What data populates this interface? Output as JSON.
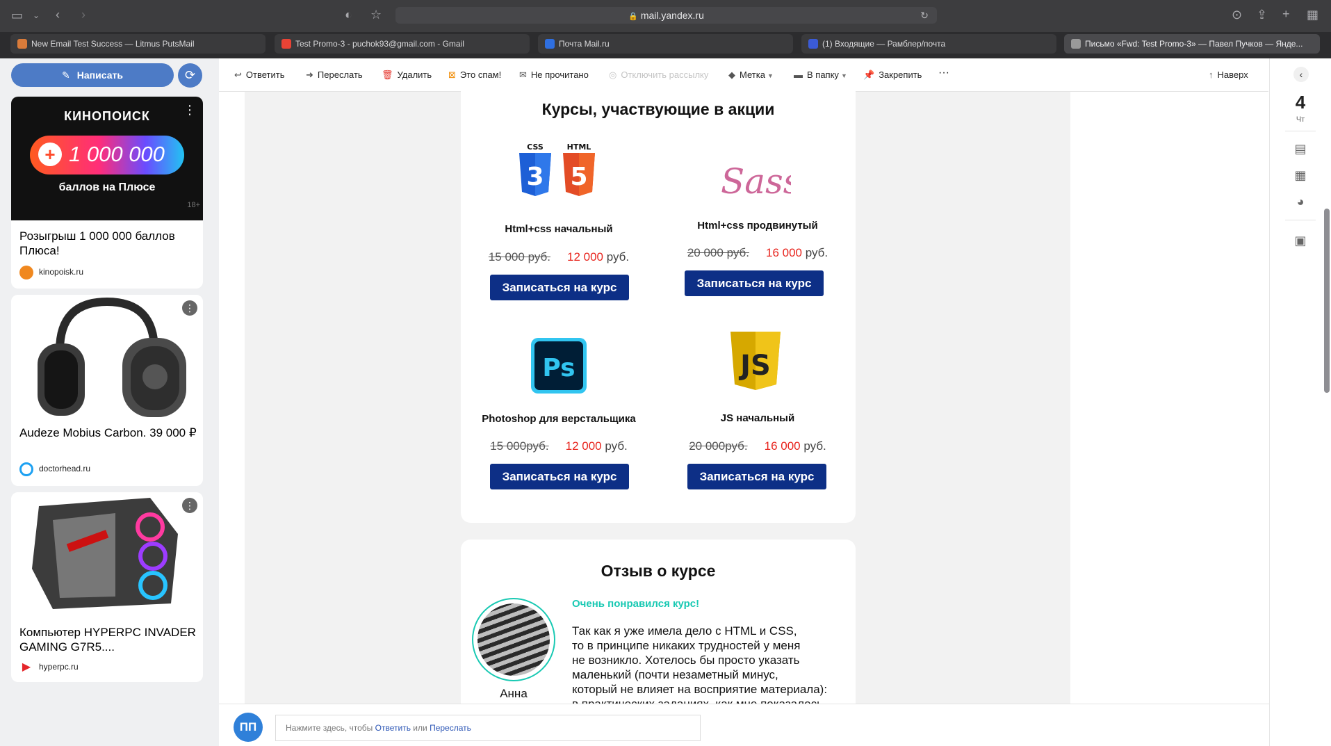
{
  "browser": {
    "url": "mail.yandex.ru",
    "tabs": [
      {
        "label": "New Email Test Success — Litmus PutsMail",
        "fav_color": "#d97b3a"
      },
      {
        "label": "Test Promo-3 - puchok93@gmail.com - Gmail",
        "fav_color": "#ea4335"
      },
      {
        "label": "Почта Mail.ru",
        "fav_color": "#2f6fe0"
      },
      {
        "label": "(1) Входящие — Рамблер/почта",
        "fav_color": "#3b5bd6"
      },
      {
        "label": "Письмо «Fwd: Test Promo-3» — Павел Пучков — Янде...",
        "fav_color": "#9a9a9a"
      }
    ]
  },
  "sidebar": {
    "compose_label": "Написать",
    "ads": [
      {
        "title": "Розыгрыш 1 000 000 баллов Плюса!",
        "source": "kinopoisk.ru",
        "banner_brand": "КИНОПОИСК",
        "banner_amount": "1 000 000",
        "banner_sub": "баллов на Плюсе",
        "banner_age": "18+"
      },
      {
        "title": "Audeze Mobius Carbon. 39 000 ₽",
        "source": "doctorhead.ru"
      },
      {
        "title": "Компьютер HYPERPC INVADER GAMING G7R5....",
        "source": "hyperpc.ru"
      }
    ]
  },
  "toolbar": {
    "reply": "Ответить",
    "forward": "Переслать",
    "delete": "Удалить",
    "spam": "Это спам!",
    "unread": "Не прочитано",
    "unsubscribe": "Отключить рассылку",
    "label": "Метка",
    "folder": "В папку",
    "pin": "Закрепить",
    "more": "···",
    "top": "Наверх"
  },
  "email": {
    "courses_title": "Курсы, участвующие в акции",
    "courses": [
      {
        "name": "Html+css начальный",
        "old_price": "15 000 руб.",
        "new_price": "12 000",
        "currency": "руб.",
        "button": "Записаться на курс",
        "icon": "css-html-icon",
        "logo_css": "CSS",
        "logo_html": "HTML",
        "logo_css_digit": "3",
        "logo_html_digit": "5"
      },
      {
        "name": "Html+css продвинутый",
        "old_price": "20 000 руб.",
        "new_price": "16 000",
        "currency": "руб.",
        "button": "Записаться на курс",
        "icon": "sass-icon",
        "logo_text": "Sass"
      },
      {
        "name": "Photoshop для верстальщика",
        "old_price": "15 000руб.",
        "new_price": "12 000",
        "currency": "руб.",
        "button": "Записаться на курс",
        "icon": "photoshop-icon",
        "logo_text": "Ps"
      },
      {
        "name": "JS начальный",
        "old_price": "20 000руб.",
        "new_price": "16 000",
        "currency": "руб.",
        "button": "Записаться на курс",
        "icon": "js-icon",
        "logo_text": "JS"
      }
    ],
    "review_title": "Отзыв о курсе",
    "review_headline": "Очень понравился курс!",
    "review_lines": [
      "Так как я уже имела дело с HTML и CSS,",
      "то в принципе никаких трудностей у меня",
      "не возникло. Хотелось бы просто указать",
      "маленький (почти незаметный минус,",
      "который не влияет на восприятие материала):",
      "в практических заданиях, как мне показалось"
    ],
    "reviewer_name": "Анна"
  },
  "right_panel": {
    "day_number": "4",
    "day_name": "Чт"
  },
  "reply": {
    "avatar_initials": "ПП",
    "prefix": "Нажмите здесь, чтобы",
    "reply_link": "Ответить",
    "or": "или",
    "forward_link": "Переслать"
  }
}
